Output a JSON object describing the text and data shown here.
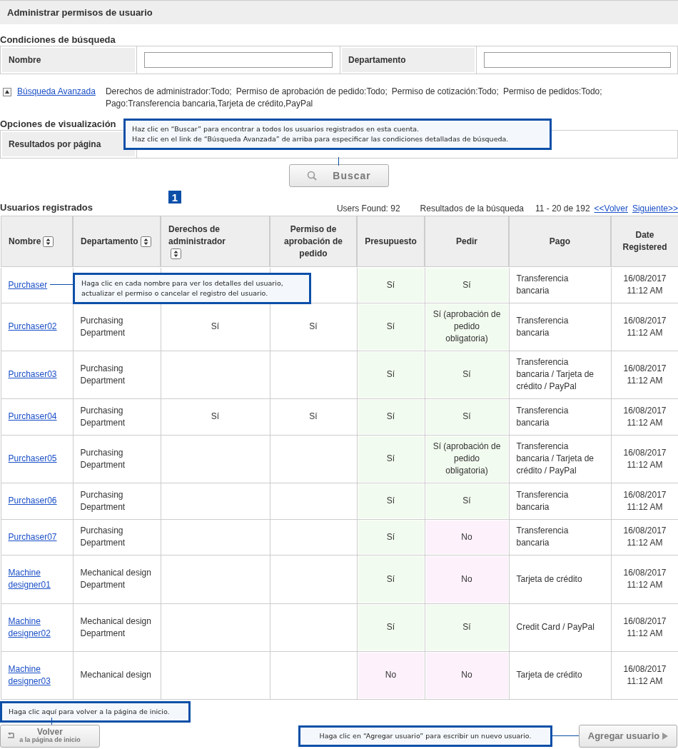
{
  "page_title": "Administrar permisos de usuario",
  "search": {
    "heading": "Condiciones de búsqueda",
    "fields": [
      {
        "label": "Nombre"
      },
      {
        "label": "Departamento"
      }
    ],
    "advanced_link": "Búsqueda Avanzada",
    "criteria": [
      "Derechos de administrador:Todo;",
      "Permiso de aprobación de pedido:Todo;",
      "Permiso de cotización:Todo;",
      "Permiso de pedidos:Todo;",
      "Pago:Transferencia bancaria,Tarjeta de crédito,PayPal"
    ]
  },
  "display": {
    "heading": "Opciones de visualización",
    "label": "Resultados por página"
  },
  "search_callout": [
    "Haz clic en “Buscar” para encontrar a todos los usuarios registrados en esta cuenta.",
    "Haz clic en el link de “Búsqueda Avanzada” de arriba para especificar las condiciones detalladas de búsqueda."
  ],
  "search_button": "Buscar",
  "results": {
    "heading": "Usuarios registrados",
    "step_badge": "1",
    "users_found": "Users Found: 92",
    "results_label": "Resultados de la búsqueda",
    "range": "11 - 20 de 192",
    "prev_link": "<<Volver",
    "next_link": "Siguiente>>"
  },
  "table": {
    "columns": [
      {
        "label": "Nombre",
        "sortable": true
      },
      {
        "label": "Departamento",
        "sortable": true
      },
      {
        "label": "Derechos de administrador",
        "sortable": true
      },
      {
        "label": "Permiso de aprobación de pedido",
        "sortable": false
      },
      {
        "label": "Presupuesto",
        "sortable": false
      },
      {
        "label": "Pedir",
        "sortable": false
      },
      {
        "label": "Pago",
        "sortable": false
      },
      {
        "label": "Date Registered",
        "sortable": false
      }
    ],
    "rows": [
      {
        "name": "Purchaser",
        "budget": {
          "text": "Sí",
          "granted": true
        },
        "order": {
          "text": "Sí",
          "granted": true
        },
        "payment": "Transferencia bancaria",
        "date": "16/08/2017 11:12 AM"
      },
      {
        "name": "Purchaser02",
        "department": "Purchasing Department",
        "admin": "Sí",
        "approval": "Sí",
        "budget": {
          "text": "Sí",
          "granted": true
        },
        "order": {
          "text": "Sí (aprobación de pedido obligatoria)",
          "granted": true
        },
        "payment": "Transferencia bancaria",
        "date": "16/08/2017 11:12 AM"
      },
      {
        "name": "Purchaser03",
        "department": "Purchasing Department",
        "budget": {
          "text": "Sí",
          "granted": true
        },
        "order": {
          "text": "Sí",
          "granted": true
        },
        "payment": "Transferencia bancaria / Tarjeta de crédito / PayPal",
        "date": "16/08/2017 11:12 AM"
      },
      {
        "name": "Purchaser04",
        "department": "Purchasing Department",
        "admin": "Sí",
        "approval": "Sí",
        "budget": {
          "text": "Sí",
          "granted": true
        },
        "order": {
          "text": "Sí",
          "granted": true
        },
        "payment": "Transferencia bancaria",
        "date": "16/08/2017 11:12 AM"
      },
      {
        "name": "Purchaser05",
        "department": "Purchasing Department",
        "budget": {
          "text": "Sí",
          "granted": true
        },
        "order": {
          "text": "Sí (aprobación de pedido obligatoria)",
          "granted": true
        },
        "payment": "Transferencia bancaria / Tarjeta de crédito / PayPal",
        "date": "16/08/2017 11:12 AM"
      },
      {
        "name": "Purchaser06",
        "department": "Purchasing Department",
        "budget": {
          "text": "Sí",
          "granted": true
        },
        "order": {
          "text": "Sí",
          "granted": true
        },
        "payment": "Transferencia bancaria",
        "date": "16/08/2017 11:12 AM"
      },
      {
        "name": "Purchaser07",
        "department": "Purchasing Department",
        "budget": {
          "text": "Sí",
          "granted": true
        },
        "order": {
          "text": "No",
          "granted": false
        },
        "payment": "Transferencia bancaria",
        "date": "16/08/2017 11:12 AM"
      },
      {
        "name": "Machine designer01",
        "department": "Mechanical design Department",
        "budget": {
          "text": "Sí",
          "granted": true
        },
        "order": {
          "text": "No",
          "granted": false
        },
        "payment": "Tarjeta de crédito",
        "date": "16/08/2017 11:12 AM"
      },
      {
        "name": "Machine designer02",
        "department": "Mechanical design Department",
        "budget": {
          "text": "Sí",
          "granted": true
        },
        "order": {
          "text": "Sí",
          "granted": true
        },
        "payment": "Credit Card / PayPal",
        "date": "16/08/2017 11:12 AM"
      },
      {
        "name": "Machine designer03",
        "department": "Mechanical design",
        "budget": {
          "text": "No",
          "granted": false
        },
        "order": {
          "text": "No",
          "granted": false
        },
        "payment": "Tarjeta de crédito",
        "date": "16/08/2017 11:12 AM"
      }
    ]
  },
  "name_callout": [
    "Haga clic en cada nombre para ver los detalles del usuario,",
    "actualizar el permiso o cancelar el registro del usuario."
  ],
  "home_callout": "Haga clic aquí para volver a la página de inicio.",
  "back_button": {
    "label": "Volver",
    "sublabel": "a la página de inicio"
  },
  "add_callout": "Haga clic en “Agregar usuario” para escribir un nuevo usuario.",
  "add_button": "Agregar usuario"
}
